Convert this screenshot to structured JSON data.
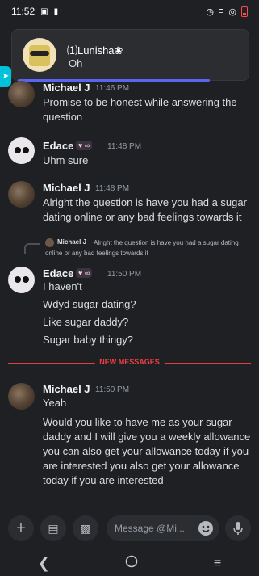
{
  "status_bar": {
    "time": "11:52"
  },
  "notification": {
    "sender": "⑴Lunisha❀",
    "message": "Oh"
  },
  "messages": [
    {
      "author": "Michael J",
      "time": "11:46 PM",
      "lines": [
        "Promise to be honest while answering the",
        "question"
      ]
    },
    {
      "author": "Edace",
      "time": "11:48 PM",
      "lines": [
        "Uhm sure"
      ]
    },
    {
      "author": "Michael J",
      "time": "11:48 PM",
      "lines": [
        "Alright the question is have you had a sugar",
        "dating online or any bad feelings towards it"
      ]
    },
    {
      "author": "Edace",
      "time": "11:50 PM",
      "reply": {
        "author": "Michael J",
        "text": "Alright the question is have you had a sugar dating online or any bad feelings towards it"
      },
      "lines": [
        "I haven't",
        "Wdyd sugar dating?",
        "Like sugar daddy?",
        "Sugar baby thingy?"
      ]
    },
    {
      "author": "Michael J",
      "time": "11:50 PM",
      "lines": [
        "Yeah",
        "Would you like to have me as your sugar",
        "daddy and I will give you a weekly allowance",
        "you can also get your allowance today if you",
        "are interested you also get your allowance",
        "today if you are interested"
      ]
    }
  ],
  "divider": {
    "label": "NEW MESSAGES"
  },
  "composer": {
    "placeholder": "Message @Mi..."
  },
  "colors": {
    "background": "#1f2024",
    "accent": "#5865f2",
    "new_messages": "#f23f43"
  }
}
